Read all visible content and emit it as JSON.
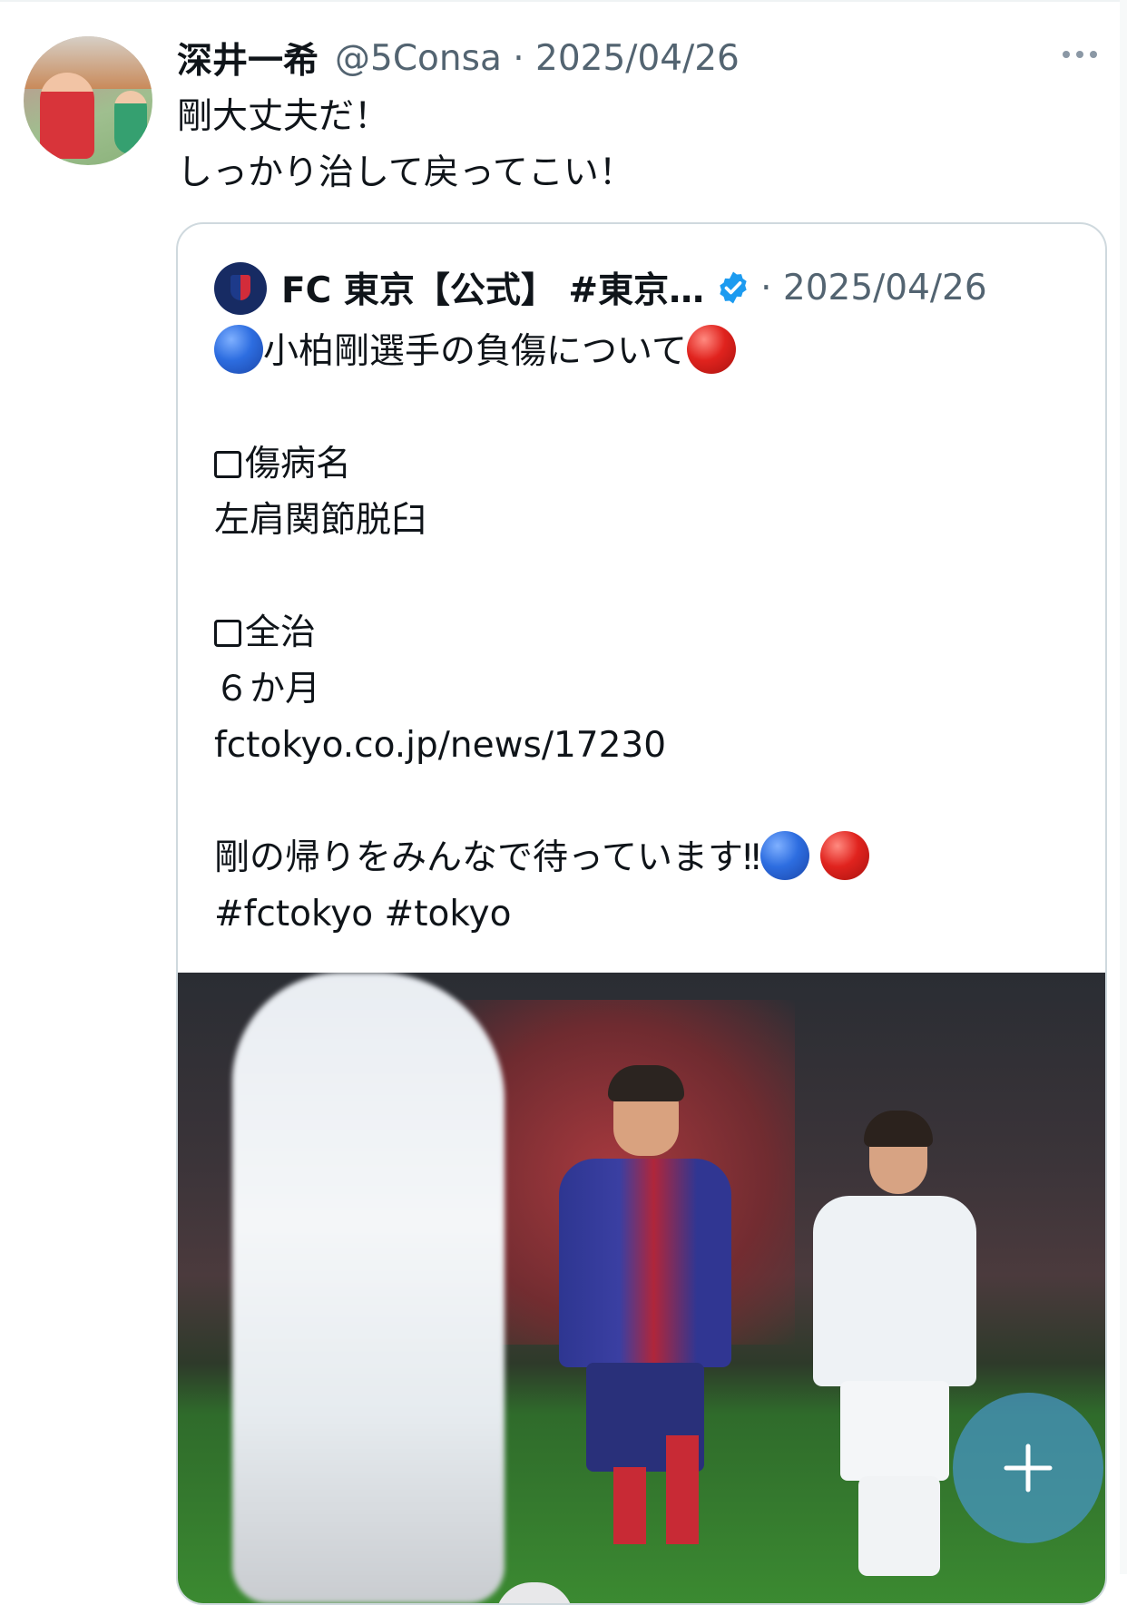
{
  "tweet": {
    "display_name": "深井一希",
    "handle_time": "@5Consa · 2025/04/26",
    "text_lines": [
      "剛大丈夫だ！",
      "しっかり治して戻ってこい！"
    ]
  },
  "quote": {
    "name": "FC 東京【公式】 #東京…",
    "time": "· 2025/04/26",
    "title": "小柏剛選手の負傷について",
    "label_injury": "傷病名",
    "injury": "左肩関節脱臼",
    "label_recovery": "全治",
    "recovery": "６か月",
    "link": "fctokyo.co.jp/news/17230",
    "message": "剛の帰りをみんなで待っています‼",
    "hashtags": "#fctokyo #tokyo"
  },
  "colors": {
    "text": "#0f1419",
    "secondary": "#536471",
    "verified": "#1d9bf0",
    "border": "#cfd9de",
    "fab": "#4696c8"
  },
  "icons": {
    "more": "more-icon",
    "verified": "verified-badge-icon",
    "compose": "plus-icon",
    "blue_circle": "blue-circle-emoji",
    "red_circle": "red-circle-emoji"
  }
}
